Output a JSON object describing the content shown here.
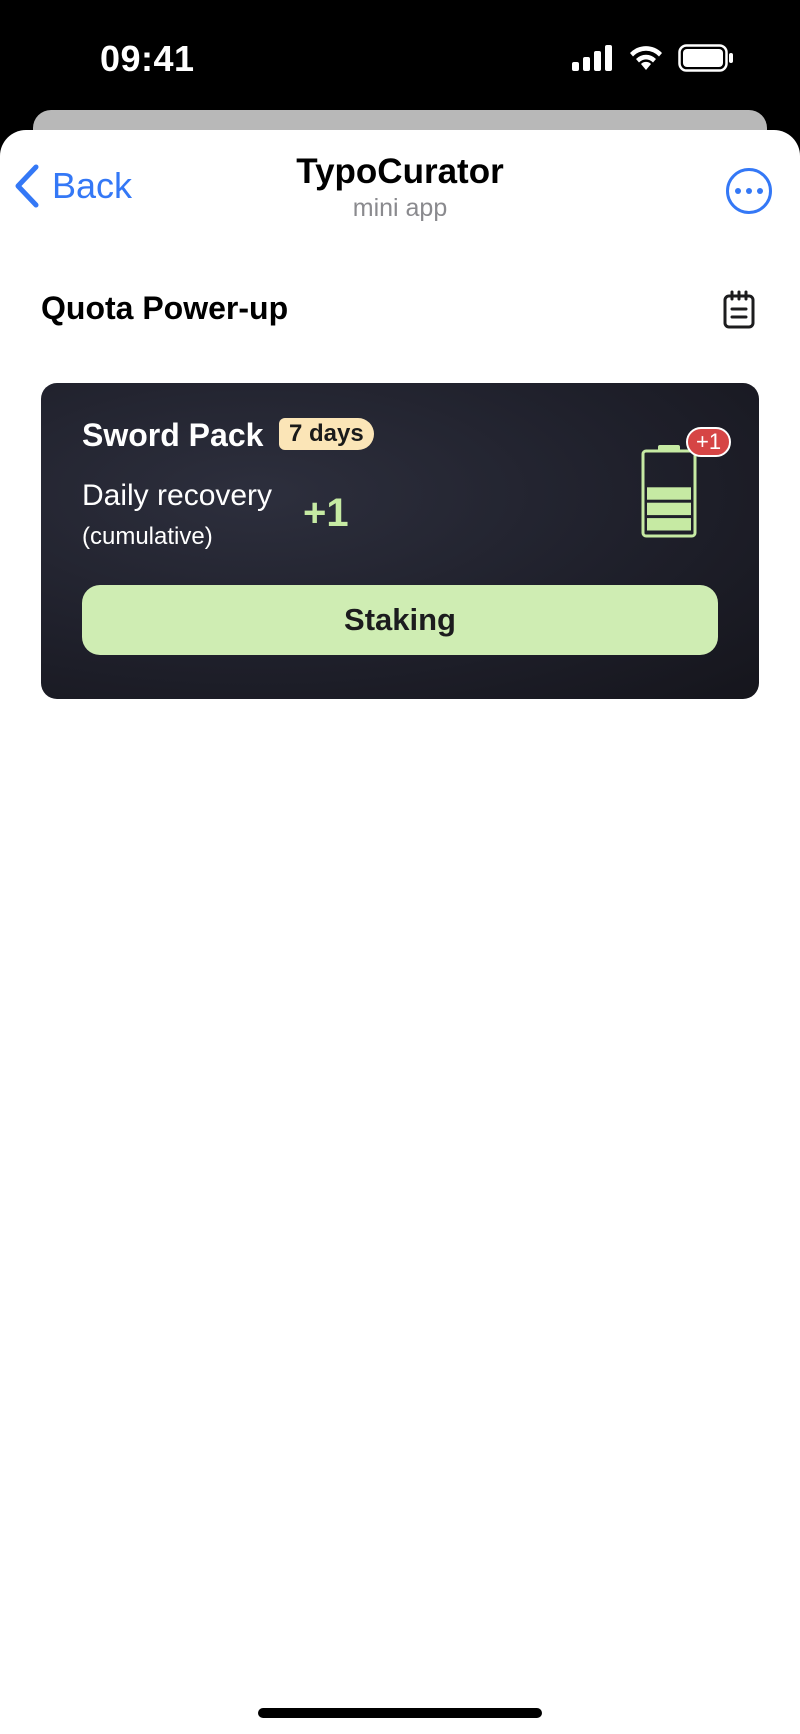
{
  "status_bar": {
    "time": "09:41"
  },
  "nav": {
    "back_label": "Back",
    "title": "TypoCurator",
    "subtitle": "mini app"
  },
  "section": {
    "title": "Quota Power-up"
  },
  "card": {
    "pack_name": "Sword Pack",
    "duration_badge": "7 days",
    "recovery_label": "Daily recovery",
    "recovery_sub": "(cumulative)",
    "recovery_value": "+1",
    "battery_badge": "+1",
    "battery_level": 0.6,
    "action_label": "Staking"
  },
  "colors": {
    "accent_blue": "#3478f6",
    "card_bg": "#1f202b",
    "highlight_green": "#c6eaa3",
    "button_green": "#cfedb3",
    "badge_yellow": "#fbe5b7",
    "badge_red": "#d64545"
  },
  "icons": {
    "back": "chevron-left-icon",
    "more": "ellipsis-circle-icon",
    "records": "clipboard-list-icon",
    "battery": "battery-icon",
    "signal": "cellular-signal-icon",
    "wifi": "wifi-icon",
    "status_battery": "status-battery-icon"
  }
}
